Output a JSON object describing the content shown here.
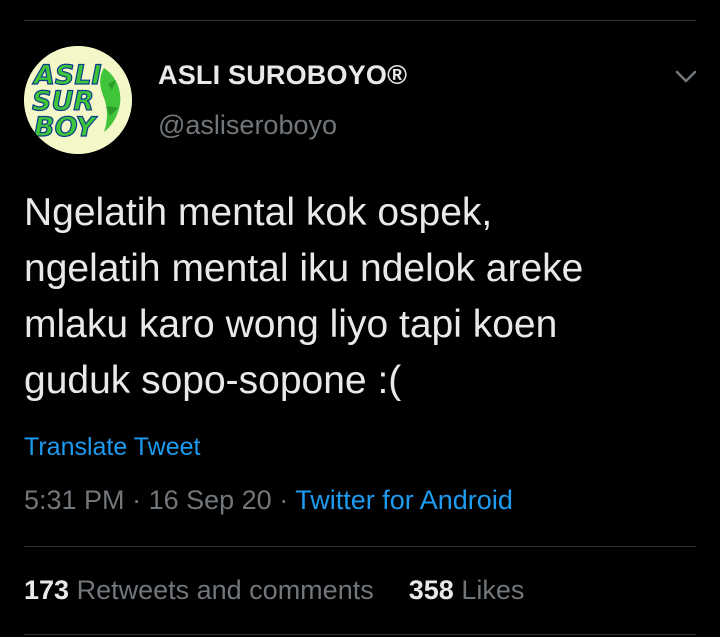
{
  "tweet": {
    "author": {
      "display_name": "ASLI SUROBOYO®",
      "handle": "@asliseroboyo",
      "avatar_logo_text": [
        "ASLI",
        "SUR",
        "BOY"
      ]
    },
    "text_lines": [
      "Ngelatih mental kok ospek,",
      "ngelatih mental iku ndelok areke",
      "mlaku karo wong liyo tapi koen",
      "guduk sopo-sopone :("
    ],
    "translate_label": "Translate Tweet",
    "time": "5:31 PM",
    "separator": "·",
    "date": "16 Sep 20",
    "source": "Twitter for Android",
    "stats": {
      "retweets_count": "173",
      "retweets_label": "Retweets and comments",
      "likes_count": "358",
      "likes_label": "Likes"
    }
  },
  "colors": {
    "background": "#000000",
    "primary_text": "#e7e9ea",
    "secondary_text": "#71767b",
    "link": "#1d9bf0",
    "divider": "#2f3336",
    "avatar_bg": "#f4f7c8",
    "avatar_green": "#3fc43a"
  },
  "icons": {
    "menu": "chevron-down-icon"
  }
}
